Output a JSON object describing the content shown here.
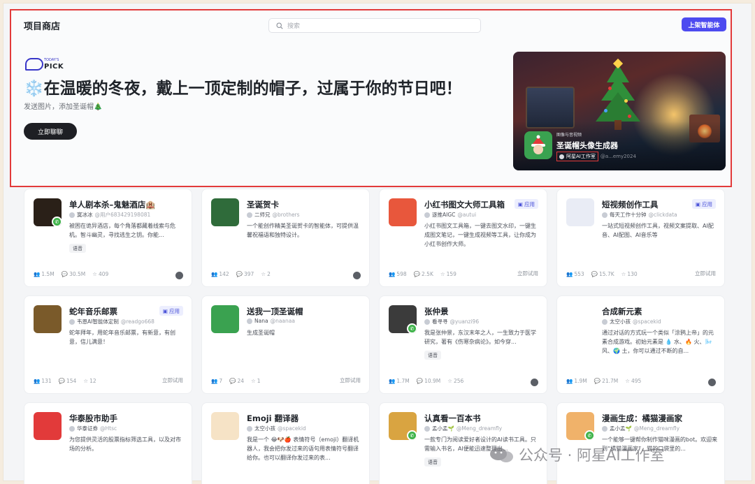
{
  "header": {
    "title": "项目商店",
    "search_placeholder": "搜索",
    "publish_label": "上架智能体"
  },
  "hero": {
    "badge_top": "TODAY'S",
    "badge_main": "PICK",
    "title": "❄️在温暖的冬夜，戴上一顶定制的帽子，过属于你的节日吧！",
    "subtitle": "发送图片，添加圣诞帽🎄",
    "cta": "立即聊聊",
    "banner": {
      "category": "图像与音视频",
      "name": "圣诞帽头像生成器",
      "author": "阿星AI工作室",
      "handle": "@a...emy2024"
    }
  },
  "cards": [
    {
      "title": "单人剧本杀–鬼魅酒店🏨",
      "author": "寞冰冰",
      "handle": "@用户683429198081",
      "desc": "被困在诡异酒店，每个角落都藏着线索与危机。智斗幽灵，寻找逃生之钥。你能...",
      "label": "语音",
      "stats": [
        "1.5M",
        "30.5M",
        "409"
      ],
      "tag": "",
      "action": "",
      "icon": "haunted-hotel-icon",
      "icon_color": "#2a2018",
      "phone": true
    },
    {
      "title": "圣诞贺卡",
      "author": "二师兄",
      "handle": "@brothers",
      "desc": "一个能创作精美圣诞贺卡的智能体，可提供温馨祝福语和独特设计。",
      "label": "",
      "stats": [
        "142",
        "397",
        "2"
      ],
      "tag": "",
      "action": "",
      "icon": "christmas-card-icon",
      "icon_color": "#2f6b3a",
      "phone": false
    },
    {
      "title": "小红书图文大师工具箱",
      "author": "逐推AIGC",
      "handle": "@autui",
      "desc": "小红书图文工具箱，一键去图文水印，一键生成图文笔记，一键生成视频等工具，让你成为小红书创作大师。",
      "label": "",
      "stats": [
        "598",
        "2.5K",
        "159"
      ],
      "tag": "应用",
      "action": "立即试用",
      "icon": "xiaohongshu-toolbox-icon",
      "icon_color": "#e8573c",
      "phone": false
    },
    {
      "title": "短视频创作工具",
      "author": "每天工作十分钟",
      "handle": "@clickdata",
      "desc": "一站式短视频创作工具，视频文案提取、AI配音、AI配图、AI音乐等",
      "label": "",
      "stats": [
        "553",
        "15.7K",
        "130"
      ],
      "tag": "应用",
      "action": "立即试用",
      "icon": "short-video-icon",
      "icon_color": "#e9ecf5",
      "phone": false
    },
    {
      "title": "蛇年音乐邮票",
      "author": "韦恩AI智能体定制",
      "handle": "@readgo668",
      "desc": "蛇年拜年，用蛇年音乐邮票，有新意，有创意，信儿满意！",
      "label": "",
      "stats": [
        "131",
        "154",
        "12"
      ],
      "tag": "应用",
      "action": "立即试用",
      "icon": "snake-stamp-icon",
      "icon_color": "#7a5a2a",
      "phone": false
    },
    {
      "title": "送我一顶圣诞帽",
      "author": "Nana",
      "handle": "@naanaa",
      "desc": "生成圣诞帽",
      "label": "",
      "stats": [
        "7",
        "24",
        "1"
      ],
      "tag": "",
      "action": "立即试用",
      "icon": "santa-hat-girl-icon",
      "icon_color": "#3aa250",
      "phone": false
    },
    {
      "title": "张仲景",
      "author": "看寻寻",
      "handle": "@yuanzi96",
      "desc": "我是张仲景，东汉末年之人，一生致力于医学研究，著有《伤寒杂病论》。如今穿...",
      "label": "语音",
      "stats": [
        "1.7M",
        "10.9M",
        "256"
      ],
      "tag": "",
      "action": "",
      "icon": "zhang-zhongjing-icon",
      "icon_color": "#3b3b3b",
      "phone": true
    },
    {
      "title": "合成新元素",
      "author": "太空小孩",
      "handle": "@spacekid",
      "desc": "通过对话的方式玩一个类似「涂鸦上帝」的元素合成游戏。初始元素是 💧 水、🔥 火、🌬️ 风、🌍 土，你可以通过不断的自...",
      "label": "",
      "stats": [
        "1.9M",
        "21.7M",
        "495"
      ],
      "tag": "",
      "action": "",
      "icon": "elements-icon",
      "icon_color": "#ffffff",
      "phone": false
    },
    {
      "title": "华泰股市助手",
      "author": "华泰证券",
      "handle": "@Htsc",
      "desc": "为您提供灵活的股票指标筛选工具，以及对市场的分析。",
      "label": "",
      "stats": [],
      "tag": "",
      "action": "",
      "icon": "huatai-logo-icon",
      "icon_color": "#e23a3a",
      "phone": false
    },
    {
      "title": "Emoji 翻译器",
      "author": "太空小孩",
      "handle": "@spacekid",
      "desc": "我是一个 😂🐶🍎 表情符号（emoji）翻译机器人，我会把你发过来的语句用表情符号翻译给你。也可以翻译你发过来的表...",
      "label": "",
      "stats": [],
      "tag": "",
      "action": "",
      "icon": "emoji-translator-icon",
      "icon_color": "#f6e3c6",
      "phone": false
    },
    {
      "title": "认真看一百本书",
      "author": "孟小孟🌱",
      "handle": "@Meng_dreamfly",
      "desc": "一款专门为阅读爱好者设计的AI读书工具。只需输入书名，AI便能迅速整理出...",
      "label": "语音",
      "stats": [],
      "tag": "",
      "action": "",
      "icon": "book-reading-icon",
      "icon_color": "#d9a441",
      "phone": true
    },
    {
      "title": "漫画生成：橘猫漫画家",
      "author": "孟小孟🌱",
      "handle": "@Meng_dreamfly",
      "desc": "一个能够一键帮你制作猫咪漫画的bot。欢迎来到“橘猫漫画家”，猫的口袋里的...",
      "label": "",
      "stats": [],
      "tag": "",
      "action": "",
      "icon": "orange-cat-icon",
      "icon_color": "#f0b26a",
      "phone": true
    }
  ],
  "watermark": "公众号 · 阿星AI工作室"
}
